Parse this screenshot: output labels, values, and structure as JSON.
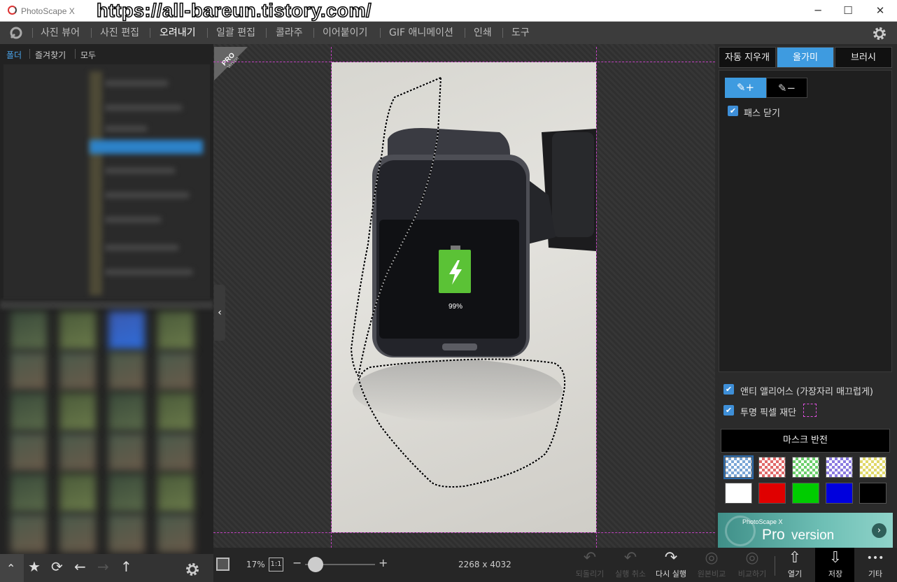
{
  "titlebar": {
    "app_title": "PhotoScape X",
    "watermark": "https://all-bareun.tistory.com/"
  },
  "menu": {
    "items": [
      "사진 뷰어",
      "사진 편집",
      "오려내기",
      "일괄 편집",
      "콜라주",
      "이어붙이기",
      "GIF 애니메이션",
      "인쇄",
      "도구"
    ],
    "active": "오려내기"
  },
  "left": {
    "tabs": [
      "폴더",
      "즐겨찾기",
      "모두"
    ],
    "active_tab": "폴더"
  },
  "canvas": {
    "pro_badge": "PRO",
    "pro_sub": "Version",
    "battery_text": "99%"
  },
  "bottom": {
    "zoom": "17%",
    "ratio": "1:1",
    "dimensions": "2268 x 4032",
    "actions": [
      {
        "label": "되돌리기",
        "icon": "undo-icon",
        "enabled": false
      },
      {
        "label": "실행 취소",
        "icon": "undo-icon",
        "enabled": false
      },
      {
        "label": "다시 실행",
        "icon": "redo-icon",
        "enabled": true
      },
      {
        "label": "원본비교",
        "icon": "compare-icon",
        "enabled": false
      },
      {
        "label": "비교하기",
        "icon": "compare-icon",
        "enabled": false
      },
      {
        "label": "열기",
        "icon": "open-icon",
        "enabled": true
      },
      {
        "label": "저장",
        "icon": "save-icon",
        "enabled": true
      },
      {
        "label": "기타",
        "icon": "more-icon",
        "enabled": true
      }
    ]
  },
  "right": {
    "tabs": [
      "자동 지우개",
      "올가미",
      "브러시"
    ],
    "active_tab": "올가미",
    "close_path": "패스 닫기",
    "antialias": "앤티 앨리어스 (가장자리 매끄럽게)",
    "trim": "투명 픽셀 재단",
    "invert_mask": "마스크 반전",
    "swatch_colors": [
      "checker-blue",
      "checker-red",
      "checker-green",
      "checker-purple",
      "checker-yellow",
      "#ffffff",
      "#e00000",
      "#00cc00",
      "#0000dd",
      "#000000"
    ],
    "promo_brand": "PhotoScape X",
    "promo_title": "Pro",
    "promo_sub": "version"
  },
  "colors": {
    "accent": "#3e9be0",
    "guide": "#c040c0"
  }
}
